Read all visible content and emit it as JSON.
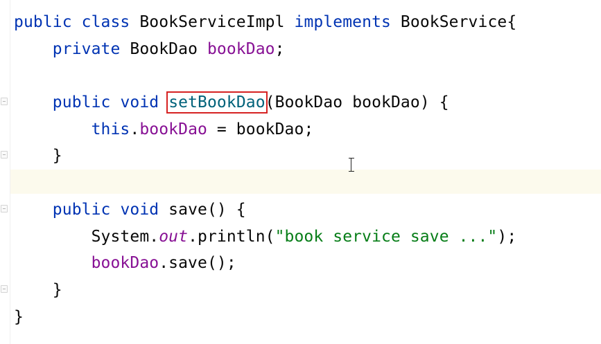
{
  "editor": {
    "lines": [
      [
        "public",
        " ",
        "class",
        " BookServiceImpl ",
        "implements",
        " BookService{"
      ],
      [
        "    ",
        "private",
        " BookDao ",
        "bookDao",
        ";"
      ],
      [
        ""
      ],
      [
        "    ",
        "public",
        " ",
        "void",
        " ",
        "setBookDao",
        "(BookDao bookDao) {"
      ],
      [
        "        ",
        "this",
        ".",
        "bookDao",
        " = bookDao;"
      ],
      [
        "    }"
      ],
      [
        ""
      ],
      [
        "    ",
        "public",
        " ",
        "void",
        " save() {"
      ],
      [
        "        System.",
        "out",
        ".println(",
        "\"book service save ...\"",
        ");"
      ],
      [
        "        ",
        "bookDao",
        ".save();"
      ],
      [
        "    }"
      ],
      [
        "}"
      ]
    ]
  },
  "colors": {
    "keyword": "#0033b3",
    "field": "#871094",
    "string": "#067d17",
    "method": "#00627a",
    "highlight_box": "#d62121",
    "caret_row": "#fcfaed"
  }
}
